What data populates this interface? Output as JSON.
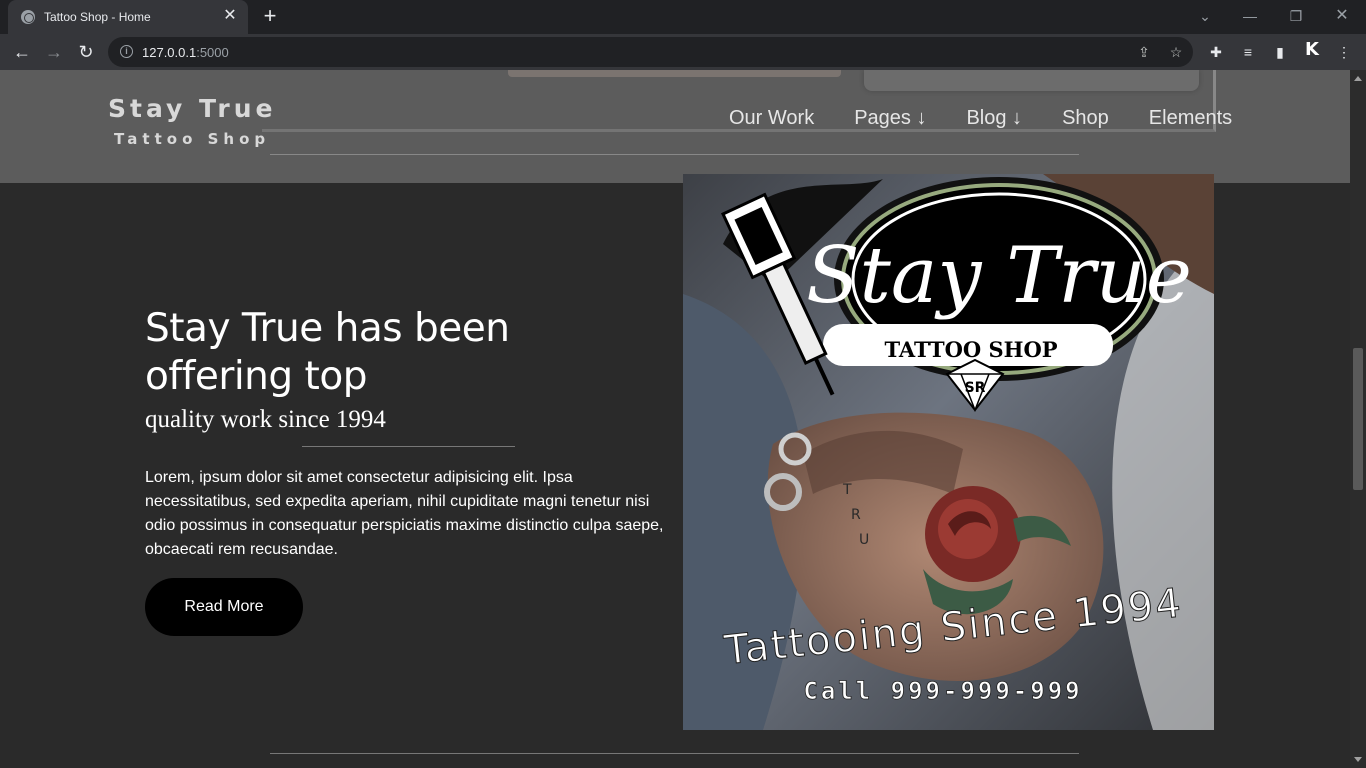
{
  "browser": {
    "tab_title": "Tattoo Shop - Home",
    "url_host": "127.0.0.1",
    "url_port": ":5000"
  },
  "header": {
    "logo_main": "Stay True",
    "logo_sub": "Tattoo Shop",
    "nav": [
      "Our Work",
      "Pages ↓",
      "Blog ↓",
      "Shop",
      "Elements"
    ]
  },
  "hero": {
    "title_line1": "Stay True has been",
    "title_line2": "offering top",
    "subtitle": "quality work since 1994",
    "body": "Lorem, ipsum dolor sit amet consectetur adipisicing elit. Ipsa necessitatibus, sed expedita aperiam, nihil cupiditate magni tenetur nisi odio possimus in consequatur perspiciatis maxime distinctio culpa saepe, obcaecati rem recusandae.",
    "button": "Read More"
  },
  "promo": {
    "brand_script": "Stay True",
    "brand_banner": "TATTOO SHOP",
    "monogram": "SR",
    "tagline": "Tattooing Since 1994",
    "phone": "Call 999-999-999"
  }
}
